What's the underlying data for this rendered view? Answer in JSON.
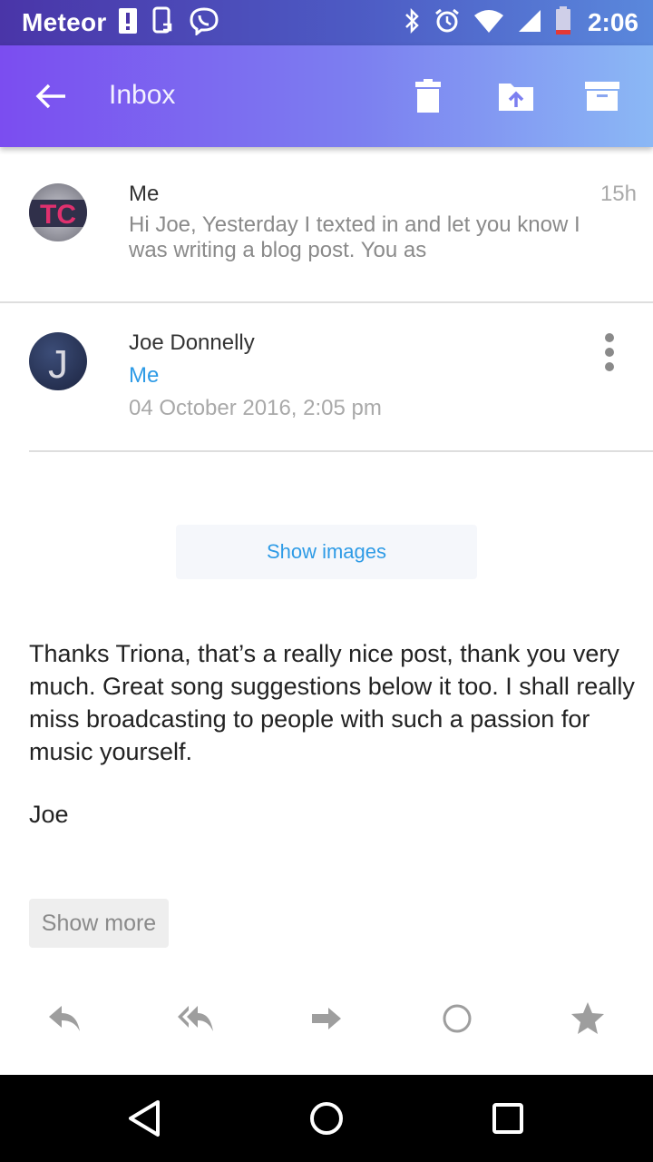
{
  "status_bar": {
    "carrier": "Meteor",
    "time": "2:06",
    "left_icons": [
      "alert-icon",
      "phone-sync-icon",
      "viber-icon"
    ],
    "right_icons": [
      "bluetooth-icon",
      "alarm-icon",
      "wifi-icon",
      "signal-icon",
      "battery-icon"
    ]
  },
  "app_bar": {
    "title": "Inbox",
    "actions": [
      "delete-icon",
      "move-to-folder-icon",
      "archive-icon"
    ]
  },
  "thread": {
    "collapsed_message": {
      "sender": "Me",
      "time": "15h",
      "snippet": "Hi Joe, Yesterday I texted in and let you know I was writing a blog post. You as",
      "avatar_initials": "TC"
    },
    "expanded_message": {
      "sender": "Joe Donnelly",
      "recipient": "Me",
      "date": "04 October 2016, 2:05 pm",
      "avatar_initial": "J",
      "show_images_label": "Show images",
      "body": "Thanks Triona, that’s a really nice post, thank you very much. Great song suggestions below it too. I shall really miss broadcasting to people with such a passion for music yourself.",
      "signature": "Joe",
      "show_more_label": "Show more"
    }
  },
  "message_actions": [
    "reply-icon",
    "reply-all-icon",
    "forward-icon",
    "mark-unread-icon",
    "star-icon"
  ],
  "colors": {
    "accent_link": "#2e9be6",
    "appbar_start": "#7b4df0",
    "appbar_end": "#8bb8f5",
    "statusbar_start": "#4a35a8"
  }
}
